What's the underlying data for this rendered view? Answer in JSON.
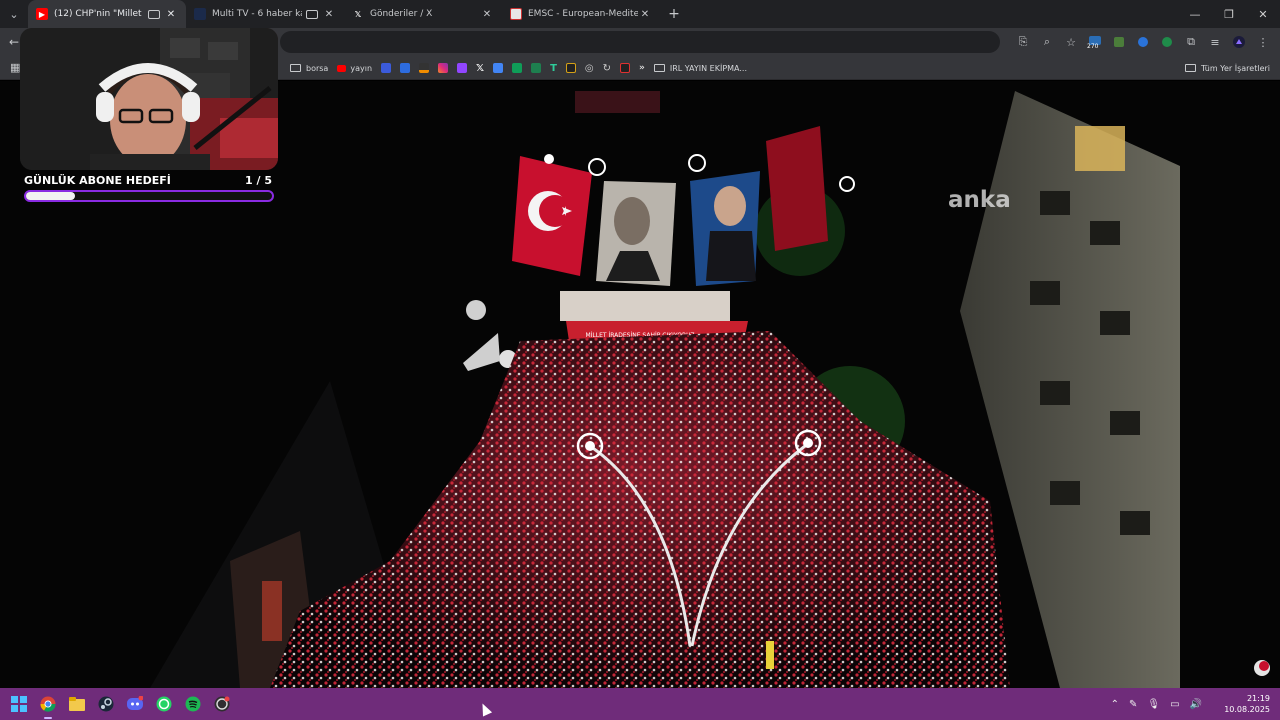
{
  "browser": {
    "tabs": [
      {
        "title": "(12) CHP'nin \"Millet İradesine",
        "favicon": "youtube-icon",
        "active": true
      },
      {
        "title": "Multi TV - 6 haber kanalını",
        "favicon": "tv-icon",
        "active": false
      },
      {
        "title": "Gönderiler / X",
        "favicon": "x-icon",
        "active": false
      },
      {
        "title": "EMSC - European-Mediterranea",
        "favicon": "emsc-icon",
        "active": false
      }
    ],
    "extension_badge": "270"
  },
  "bookmarks": {
    "items": [
      {
        "label": "borsa",
        "type": "folder"
      },
      {
        "label": "yayın",
        "type": "youtube"
      }
    ],
    "folder_irl": "IRL YAYIN EKİPMA...",
    "all_bookmarks": "Tüm Yer İşaretleri"
  },
  "overlay": {
    "goal_title": "GÜNLÜK ABONE HEDEFİ",
    "goal_count": "1  / 5",
    "goal_progress": 0.2
  },
  "video": {
    "watermark": "anka",
    "stage_banner": "MİLLET İRADESİNE SAHİP ÇIKIYORUZ"
  },
  "taskbar": {
    "apps": [
      "windows-start-icon",
      "chrome-icon",
      "file-explorer-icon",
      "steam-icon",
      "discord-icon",
      "whatsapp-icon",
      "spotify-icon",
      "obs-icon"
    ],
    "time": "21:19",
    "date": "10.08.2025"
  },
  "colors": {
    "taskbar": "#6f2c7a",
    "goal_border": "#8a2be2",
    "flag_red": "#c8102e"
  }
}
